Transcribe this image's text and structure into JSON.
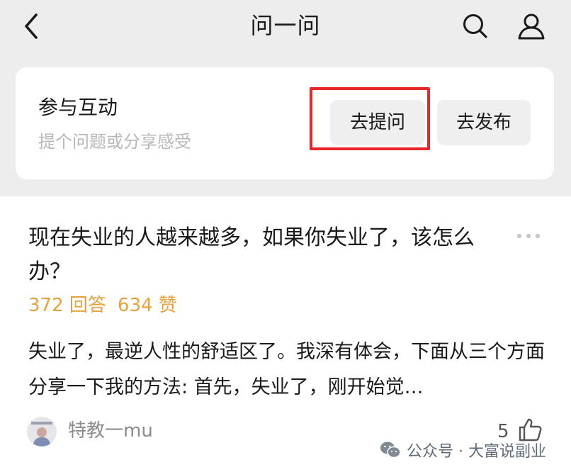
{
  "nav": {
    "title": "问一问",
    "back_icon": "chevron-left-icon",
    "search_icon": "search-icon",
    "profile_icon": "user-icon"
  },
  "engage": {
    "title": "参与互动",
    "subtitle": "提个问题或分享感受",
    "ask_button": "去提问",
    "publish_button": "去发布",
    "highlight_color": "#e8262a"
  },
  "post": {
    "title": "现在失业的人越来越多，如果你失业了，该怎么办？",
    "answers": "372 回答",
    "likes": "634 赞",
    "excerpt": "失业了，最逆人性的舒适区了。我深有体会，下面从三个方面分享一下我的方法: 首先，失业了，刚开始觉…",
    "author": "特教一mu",
    "like_count": "5",
    "stats_color": "#e6a23c"
  },
  "watermark": {
    "text": "公众号 · 大富说副业"
  }
}
